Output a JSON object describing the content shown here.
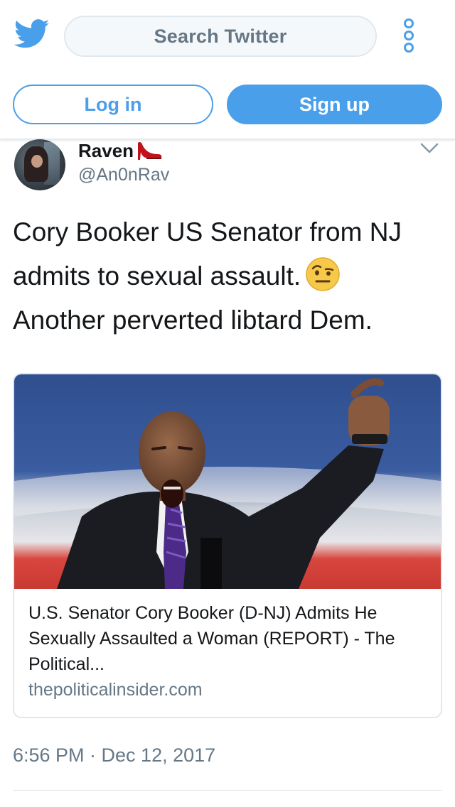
{
  "header": {
    "search_placeholder": "Search Twitter",
    "login_label": "Log in",
    "signup_label": "Sign up",
    "brand_color": "#4a9fea",
    "logo_icon": "twitter-bird-icon",
    "more_icon": "vertical-dots-icon"
  },
  "tweet": {
    "display_name": "Raven",
    "name_emoji_icon": "high-heel-icon",
    "handle": "@An0nRav",
    "text_line_1": "Cory Booker US Senator from NJ",
    "text_line_2": "admits to sexual assault.",
    "text_emoji_icon": "raised-eyebrow-emoji",
    "text_line_3": "Another perverted libtard Dem.",
    "card": {
      "title": "U.S. Senator Cory Booker (D-NJ) Admits He Sexually Assaulted a Woman (REPORT) - The Political...",
      "domain": "thepoliticalinsider.com"
    },
    "timestamp": "6:56 PM · Dec 12, 2017"
  }
}
